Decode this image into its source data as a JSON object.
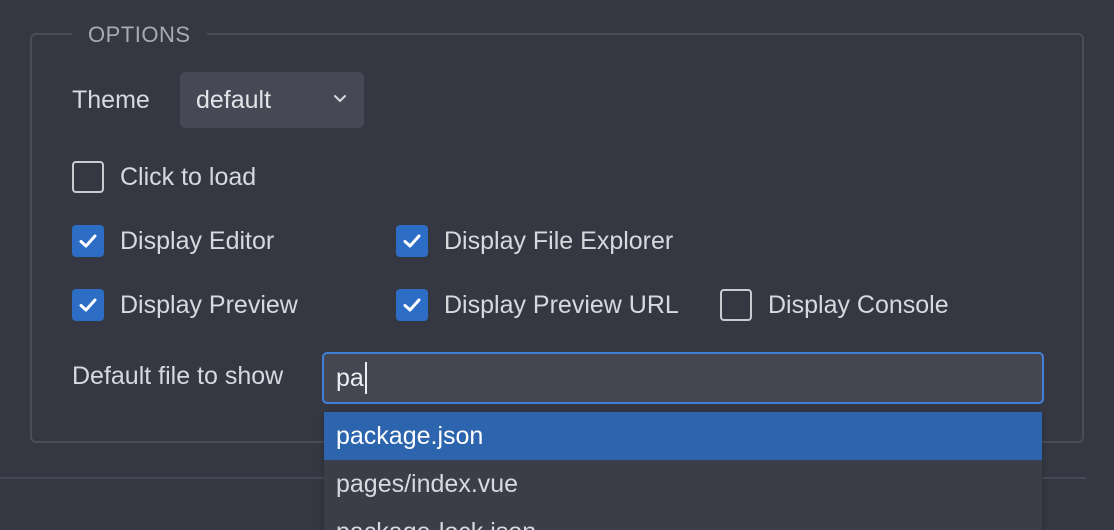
{
  "options": {
    "legend": "OPTIONS",
    "theme": {
      "label": "Theme",
      "selected": "default",
      "icon": "chevron-down-icon"
    },
    "checkboxes": [
      {
        "label": "Click to load",
        "checked": false
      },
      {
        "label": "Display Editor",
        "checked": true
      },
      {
        "label": "Display File Explorer",
        "checked": true
      },
      {
        "label": "Display Preview",
        "checked": true
      },
      {
        "label": "Display Preview URL",
        "checked": true
      },
      {
        "label": "Display Console",
        "checked": false
      }
    ],
    "default_file": {
      "label": "Default file to show",
      "value": "pa"
    },
    "suggestions": [
      "package.json",
      "pages/index.vue",
      "package-lock.json"
    ],
    "selected_suggestion": "package.json"
  },
  "colors": {
    "background": "#353842",
    "accent": "#2e6dc6",
    "highlight": "#2c64ad",
    "focus_border": "#3f7fd6"
  }
}
